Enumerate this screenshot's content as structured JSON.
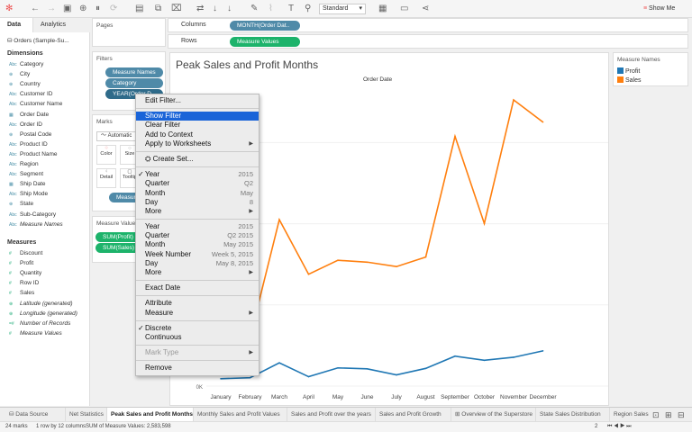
{
  "toolbar": {
    "view_size": "Standard",
    "show_me": "Show Me"
  },
  "left": {
    "tabs": [
      "Data",
      "Analytics"
    ],
    "datasource": "Orders (Sample-Su...",
    "dimensions_label": "Dimensions",
    "dimensions": [
      {
        "t": "Abc",
        "n": "Category"
      },
      {
        "t": "⊕",
        "n": "City"
      },
      {
        "t": "⊕",
        "n": "Country"
      },
      {
        "t": "Abc",
        "n": "Customer ID"
      },
      {
        "t": "Abc",
        "n": "Customer Name"
      },
      {
        "t": "▦",
        "n": "Order Date"
      },
      {
        "t": "Abc",
        "n": "Order ID"
      },
      {
        "t": "⊕",
        "n": "Postal Code"
      },
      {
        "t": "Abc",
        "n": "Product ID"
      },
      {
        "t": "Abc",
        "n": "Product Name"
      },
      {
        "t": "Abc",
        "n": "Region"
      },
      {
        "t": "Abc",
        "n": "Segment"
      },
      {
        "t": "▦",
        "n": "Ship Date"
      },
      {
        "t": "Abc",
        "n": "Ship Mode"
      },
      {
        "t": "⊕",
        "n": "State"
      },
      {
        "t": "Abc",
        "n": "Sub-Category"
      },
      {
        "t": "Abc",
        "n": "Measure Names",
        "i": true
      }
    ],
    "measures_label": "Measures",
    "measures": [
      {
        "t": "#",
        "n": "Discount"
      },
      {
        "t": "#",
        "n": "Profit"
      },
      {
        "t": "#",
        "n": "Quantity"
      },
      {
        "t": "#",
        "n": "Row ID"
      },
      {
        "t": "#",
        "n": "Sales"
      },
      {
        "t": "⊕",
        "n": "Latitude (generated)",
        "i": true
      },
      {
        "t": "⊕",
        "n": "Longitude (generated)",
        "i": true
      },
      {
        "t": "=#",
        "n": "Number of Records",
        "i": true
      },
      {
        "t": "#",
        "n": "Measure Values",
        "i": true
      }
    ]
  },
  "pages": {
    "label": "Pages"
  },
  "filters": {
    "label": "Filters",
    "pills": [
      "Measure Names",
      "Category",
      "YEAR(Order D..."
    ]
  },
  "marks": {
    "label": "Marks",
    "type": "Automatic",
    "buttons": [
      "Color",
      "Size",
      "Detail",
      "Tooltip"
    ],
    "pill": "Measure"
  },
  "measure_values": {
    "label": "Measure Values",
    "pills": [
      "SUM(Profit)",
      "SUM(Sales)"
    ]
  },
  "columns": {
    "label": "Columns",
    "pill": "MONTH(Order Dat.."
  },
  "rows": {
    "label": "Rows",
    "pill": "Measure Values"
  },
  "legend": {
    "title": "Measure Names",
    "items": [
      {
        "name": "Profit",
        "color": "#1f77b4"
      },
      {
        "name": "Sales",
        "color": "#ff7f0e"
      }
    ]
  },
  "chart_data": {
    "type": "line",
    "title": "Peak Sales and Profit Months",
    "xlabel": "Order Date",
    "y_tick_visible": "0K",
    "categories": [
      "January",
      "February",
      "March",
      "April",
      "May",
      "June",
      "July",
      "August",
      "September",
      "October",
      "November",
      "December"
    ],
    "series": [
      {
        "name": "Profit",
        "color": "#1f77b4",
        "values": [
          9.1,
          10.3,
          28.6,
          11.6,
          22.4,
          21.3,
          13.8,
          21.8,
          36.9,
          31.8,
          35.5,
          43.4
        ]
      },
      {
        "name": "Sales",
        "color": "#ff7f0e",
        "values": [
          94.9,
          59.8,
          205.0,
          137.8,
          155.0,
          152.7,
          147.2,
          159.0,
          307.6,
          200.3,
          352.5,
          325.3
        ]
      }
    ],
    "units": "K"
  },
  "menu": {
    "items": [
      {
        "l": "Edit Filter..."
      },
      {
        "sep": 1
      },
      {
        "l": "Show Filter",
        "hi": 1
      },
      {
        "l": "Clear Filter"
      },
      {
        "l": "Add to Context"
      },
      {
        "l": "Apply to Worksheets",
        "ar": 1
      },
      {
        "sep": 1
      },
      {
        "l": "Create Set...",
        "icon": 1
      },
      {
        "sep": 1
      },
      {
        "l": "Year",
        "v": "2015",
        "ck": 1
      },
      {
        "l": "Quarter",
        "v": "Q2"
      },
      {
        "l": "Month",
        "v": "May"
      },
      {
        "l": "Day",
        "v": "8"
      },
      {
        "l": "More",
        "ar": 1
      },
      {
        "sep": 1
      },
      {
        "l": "Year",
        "v": "2015"
      },
      {
        "l": "Quarter",
        "v": "Q2 2015"
      },
      {
        "l": "Month",
        "v": "May 2015"
      },
      {
        "l": "Week Number",
        "v": "Week 5, 2015"
      },
      {
        "l": "Day",
        "v": "May 8, 2015"
      },
      {
        "l": "More",
        "ar": 1
      },
      {
        "sep": 1
      },
      {
        "l": "Exact Date"
      },
      {
        "sep": 1
      },
      {
        "l": "Attribute"
      },
      {
        "l": "Measure",
        "ar": 1
      },
      {
        "sep": 1
      },
      {
        "l": "Discrete",
        "ck": 1
      },
      {
        "l": "Continuous"
      },
      {
        "sep": 1
      },
      {
        "l": "Mark Type",
        "ar": 1,
        "dis": 1
      },
      {
        "sep": 1
      },
      {
        "l": "Remove"
      }
    ]
  },
  "sheets": {
    "data_source": "Data Source",
    "tabs": [
      "Net Statistics",
      "Peak Sales and Profit Months",
      "Monthly Sales and Profit Values",
      "Sales and Profit over the years",
      "Sales and Profit Growth",
      "Overview of the Superstore",
      "State Sales Distribution",
      "Region Sales"
    ],
    "active": 1
  },
  "status": {
    "marks": "24 marks",
    "dims": "1 row by 12 columns",
    "sum": "SUM of Measure Values: 2,583,598",
    "page": "2"
  }
}
